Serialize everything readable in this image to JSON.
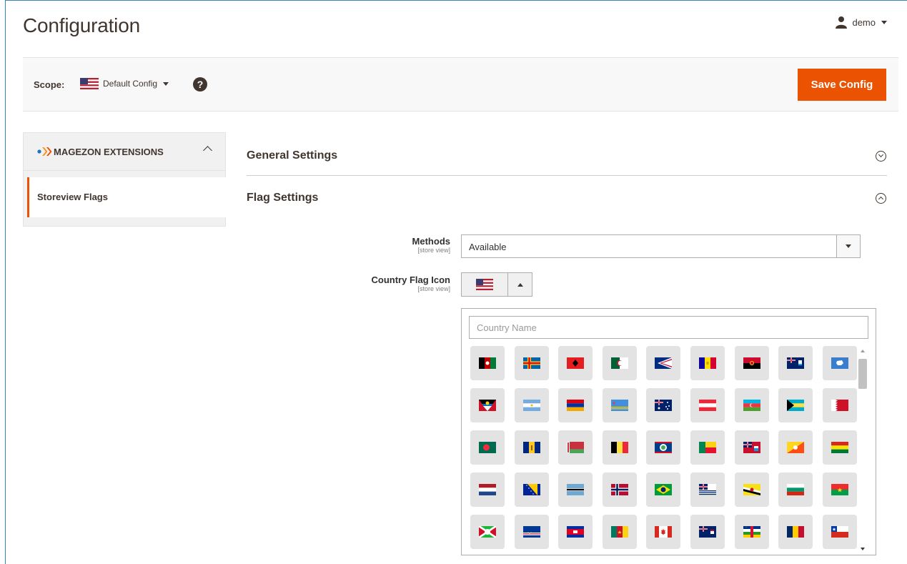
{
  "page": {
    "title": "Configuration"
  },
  "user": {
    "name": "demo"
  },
  "scope": {
    "label": "Scope:",
    "value": "Default Config",
    "help": "?"
  },
  "actions": {
    "save_label": "Save Config"
  },
  "colors": {
    "accent": "#eb5202",
    "text": "#41362f"
  },
  "sidebar": {
    "section_title": "MAGEZON EXTENSIONS",
    "items": [
      {
        "label": "Storeview Flags",
        "active": true
      }
    ]
  },
  "sections": [
    {
      "title": "General Settings",
      "expanded": false
    },
    {
      "title": "Flag Settings",
      "expanded": true
    }
  ],
  "fields": {
    "methods": {
      "label": "Methods",
      "scope": "[store view]",
      "value": "Available"
    },
    "flag_icon": {
      "label": "Country Flag Icon",
      "scope": "[store view]",
      "selected_icon": "us-flag-icon"
    }
  },
  "flag_search": {
    "placeholder": "Country Name"
  },
  "flags": [
    [
      "afghanistan",
      "aland",
      "albania",
      "algeria",
      "american-samoa",
      "andorra",
      "angola",
      "anguilla",
      "antarctica"
    ],
    [
      "antigua",
      "argentina",
      "armenia",
      "aruba",
      "australia",
      "austria",
      "azerbaijan",
      "bahamas",
      "bahrain"
    ],
    [
      "bangladesh",
      "barbados",
      "belarus",
      "belgium",
      "belize",
      "benin",
      "bermuda",
      "bhutan",
      "bolivia"
    ],
    [
      "bonaire",
      "bosnia",
      "botswana",
      "bouvet",
      "brazil",
      "biot",
      "brunei",
      "bulgaria",
      "burkina-faso"
    ],
    [
      "burundi",
      "cabo-verde",
      "cambodia",
      "cameroon",
      "canada",
      "cayman",
      "car",
      "chad",
      "chile"
    ]
  ]
}
